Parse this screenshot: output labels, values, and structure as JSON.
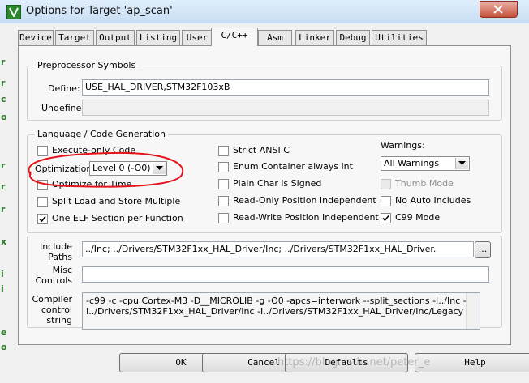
{
  "window": {
    "title": "Options for Target 'ap_scan'"
  },
  "tabs": [
    {
      "label": "Device",
      "active": false
    },
    {
      "label": "Target",
      "active": false
    },
    {
      "label": "Output",
      "active": false
    },
    {
      "label": "Listing",
      "active": false
    },
    {
      "label": "User",
      "active": false
    },
    {
      "label": "C/C++",
      "active": true
    },
    {
      "label": "Asm",
      "active": false
    },
    {
      "label": "Linker",
      "active": false
    },
    {
      "label": "Debug",
      "active": false
    },
    {
      "label": "Utilities",
      "active": false
    }
  ],
  "preprocessor": {
    "legend": "Preprocessor Symbols",
    "define_label": "Define:",
    "define_value": "USE_HAL_DRIVER,STM32F103xB",
    "undefine_label": "Undefine:",
    "undefine_value": ""
  },
  "codegen": {
    "legend": "Language / Code Generation",
    "execute_only": {
      "label": "Execute-only Code",
      "checked": false
    },
    "optimization_label": "Optimization:",
    "optimization_value": "Level 0 (-O0)",
    "optimize_time": {
      "label": "Optimize for Time",
      "checked": false
    },
    "split_load": {
      "label": "Split Load and Store Multiple",
      "checked": false
    },
    "one_elf": {
      "label": "One ELF Section per Function",
      "checked": true
    },
    "strict_ansi": {
      "label": "Strict ANSI C",
      "checked": false
    },
    "enum_container": {
      "label": "Enum Container always int",
      "checked": false
    },
    "plain_char": {
      "label": "Plain Char is Signed",
      "checked": false
    },
    "ro_pi": {
      "label": "Read-Only Position Independent",
      "checked": false
    },
    "rw_pi": {
      "label": "Read-Write Position Independent",
      "checked": false
    },
    "warnings_label": "Warnings:",
    "warnings_value": "All Warnings",
    "thumb_mode": {
      "label": "Thumb Mode",
      "checked": false,
      "disabled": true
    },
    "no_auto_includes": {
      "label": "No Auto Includes",
      "checked": false
    },
    "c99_mode": {
      "label": "C99 Mode",
      "checked": true
    }
  },
  "paths": {
    "include_label_1": "Include",
    "include_label_2": "Paths",
    "include_value": "../Inc;                 ../Drivers/STM32F1xx_HAL_Driver/Inc;                 ../Drivers/STM32F1xx_HAL_Driver.",
    "browse_label": "...",
    "misc_label_1": "Misc",
    "misc_label_2": "Controls",
    "misc_value": "",
    "compiler_label_1": "Compiler",
    "compiler_label_2": "control",
    "compiler_label_3": "string",
    "compiler_line_1": "-c99 -c -cpu Cortex-M3 -D__MICROLIB -g -O0 -apcs=interwork --split_sections -I../Inc -",
    "compiler_line_2": "I../Drivers/STM32F1xx_HAL_Driver/Inc -I../Drivers/STM32F1xx_HAL_Driver/Inc/Legacy -"
  },
  "buttons": {
    "ok": "OK",
    "cancel": "Cancel",
    "defaults": "Defaults",
    "help": "Help"
  },
  "watermark": "https://blog.csdn.net/peter_e",
  "background_marks": [
    "r",
    "r",
    "c",
    "o",
    "r",
    "r",
    "r",
    "x",
    "i",
    "i",
    "e",
    "o"
  ]
}
